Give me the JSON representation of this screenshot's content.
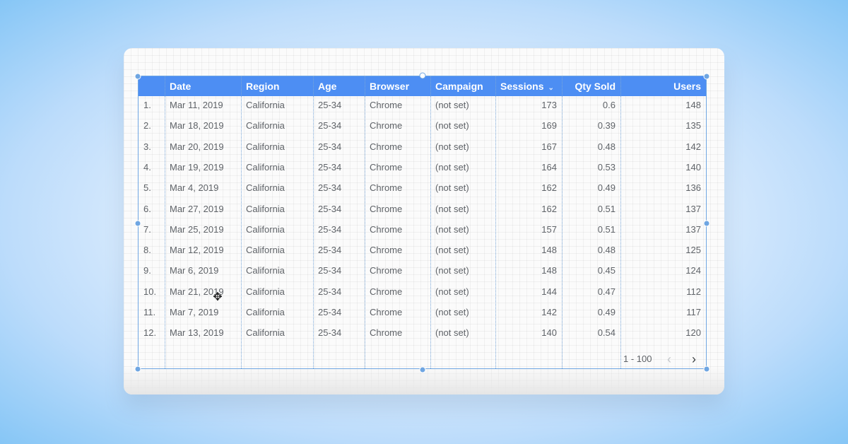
{
  "table": {
    "columns": [
      {
        "key": "idx",
        "label": "",
        "align": "left"
      },
      {
        "key": "date",
        "label": "Date",
        "align": "left"
      },
      {
        "key": "region",
        "label": "Region",
        "align": "left"
      },
      {
        "key": "age",
        "label": "Age",
        "align": "left"
      },
      {
        "key": "browser",
        "label": "Browser",
        "align": "left"
      },
      {
        "key": "campaign",
        "label": "Campaign",
        "align": "left"
      },
      {
        "key": "sessions",
        "label": "Sessions",
        "align": "left",
        "sorted": true
      },
      {
        "key": "qty",
        "label": "Qty Sold",
        "align": "right"
      },
      {
        "key": "users",
        "label": "Users",
        "align": "right"
      }
    ],
    "sort_indicator": "⌄",
    "rows": [
      {
        "idx": "1.",
        "date": "Mar 11, 2019",
        "region": "California",
        "age": "25-34",
        "browser": "Chrome",
        "campaign": "(not set)",
        "sessions": "173",
        "qty": "0.6",
        "users": "148"
      },
      {
        "idx": "2.",
        "date": "Mar 18, 2019",
        "region": "California",
        "age": "25-34",
        "browser": "Chrome",
        "campaign": "(not set)",
        "sessions": "169",
        "qty": "0.39",
        "users": "135"
      },
      {
        "idx": "3.",
        "date": "Mar 20, 2019",
        "region": "California",
        "age": "25-34",
        "browser": "Chrome",
        "campaign": "(not set)",
        "sessions": "167",
        "qty": "0.48",
        "users": "142"
      },
      {
        "idx": "4.",
        "date": "Mar 19, 2019",
        "region": "California",
        "age": "25-34",
        "browser": "Chrome",
        "campaign": "(not set)",
        "sessions": "164",
        "qty": "0.53",
        "users": "140"
      },
      {
        "idx": "5.",
        "date": "Mar 4, 2019",
        "region": "California",
        "age": "25-34",
        "browser": "Chrome",
        "campaign": "(not set)",
        "sessions": "162",
        "qty": "0.49",
        "users": "136"
      },
      {
        "idx": "6.",
        "date": "Mar 27, 2019",
        "region": "California",
        "age": "25-34",
        "browser": "Chrome",
        "campaign": "(not set)",
        "sessions": "162",
        "qty": "0.51",
        "users": "137"
      },
      {
        "idx": "7.",
        "date": "Mar 25, 2019",
        "region": "California",
        "age": "25-34",
        "browser": "Chrome",
        "campaign": "(not set)",
        "sessions": "157",
        "qty": "0.51",
        "users": "137"
      },
      {
        "idx": "8.",
        "date": "Mar 12, 2019",
        "region": "California",
        "age": "25-34",
        "browser": "Chrome",
        "campaign": "(not set)",
        "sessions": "148",
        "qty": "0.48",
        "users": "125"
      },
      {
        "idx": "9.",
        "date": "Mar 6, 2019",
        "region": "California",
        "age": "25-34",
        "browser": "Chrome",
        "campaign": "(not set)",
        "sessions": "148",
        "qty": "0.45",
        "users": "124"
      },
      {
        "idx": "10.",
        "date": "Mar 21, 2019",
        "region": "California",
        "age": "25-34",
        "browser": "Chrome",
        "campaign": "(not set)",
        "sessions": "144",
        "qty": "0.47",
        "users": "112"
      },
      {
        "idx": "11.",
        "date": "Mar 7, 2019",
        "region": "California",
        "age": "25-34",
        "browser": "Chrome",
        "campaign": "(not set)",
        "sessions": "142",
        "qty": "0.49",
        "users": "117"
      },
      {
        "idx": "12.",
        "date": "Mar 13, 2019",
        "region": "California",
        "age": "25-34",
        "browser": "Chrome",
        "campaign": "(not set)",
        "sessions": "140",
        "qty": "0.54",
        "users": "120"
      }
    ]
  },
  "pager": {
    "range_label": "1 - 100",
    "prev_glyph": "‹",
    "next_glyph": "›"
  },
  "cursor": {
    "glyph": "✥"
  },
  "colors": {
    "header_bg": "#4d8ef3",
    "selection": "#6fa6e2",
    "text": "#5f6368"
  },
  "icons": {
    "prev": "chevron-left-icon",
    "next": "chevron-right-icon",
    "cursor": "move-cursor-icon"
  }
}
